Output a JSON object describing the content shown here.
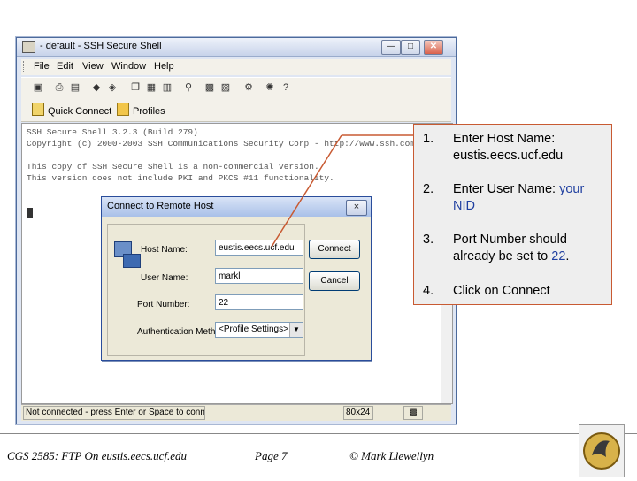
{
  "window": {
    "title": "- default - SSH Secure Shell",
    "menu": [
      "File",
      "Edit",
      "View",
      "Window",
      "Help"
    ],
    "quick_connect": "Quick Connect",
    "profiles": "Profiles",
    "terminal_lines": [
      "SSH Secure Shell 3.2.3 (Build 279)",
      "Copyright (c) 2000-2003 SSH Communications Security Corp - http://www.ssh.com",
      "This copy of SSH Secure Shell is a non-commercial version.",
      "This version does not include PKI and PKCS #11 functionality."
    ],
    "status": {
      "message": "Not connected - press Enter or Space to conne",
      "size": "80x24"
    }
  },
  "dialog": {
    "title": "Connect to Remote Host",
    "close": "×",
    "host_label": "Host Name:",
    "host_value": "eustis.eecs.ucf.edu",
    "user_label": "User Name:",
    "user_value": "markl",
    "port_label": "Port Number:",
    "port_value": "22",
    "auth_label": "Authentication Method:",
    "auth_value": "<Profile Settings>",
    "connect": "Connect",
    "cancel": "Cancel"
  },
  "steps": [
    {
      "num": "1.",
      "text": "Enter Host Name: eustis.eecs.ucf.edu"
    },
    {
      "num": "2.",
      "text_a": "Enter User Name: ",
      "text_b": "your NID"
    },
    {
      "num": "3.",
      "text_a": "Port Number should already be set to ",
      "text_b": "22",
      "text_c": "."
    },
    {
      "num": "4.",
      "text": "Click on Connect"
    }
  ],
  "footer": {
    "course": "CGS 2585: FTP On eustis.eecs.ucf.edu",
    "page": "Page 7",
    "author": "© Mark Llewellyn"
  },
  "colors": {
    "highlight": "#1f3fa0",
    "callout_border": "#c85a32",
    "arrow": "#c85a32"
  }
}
